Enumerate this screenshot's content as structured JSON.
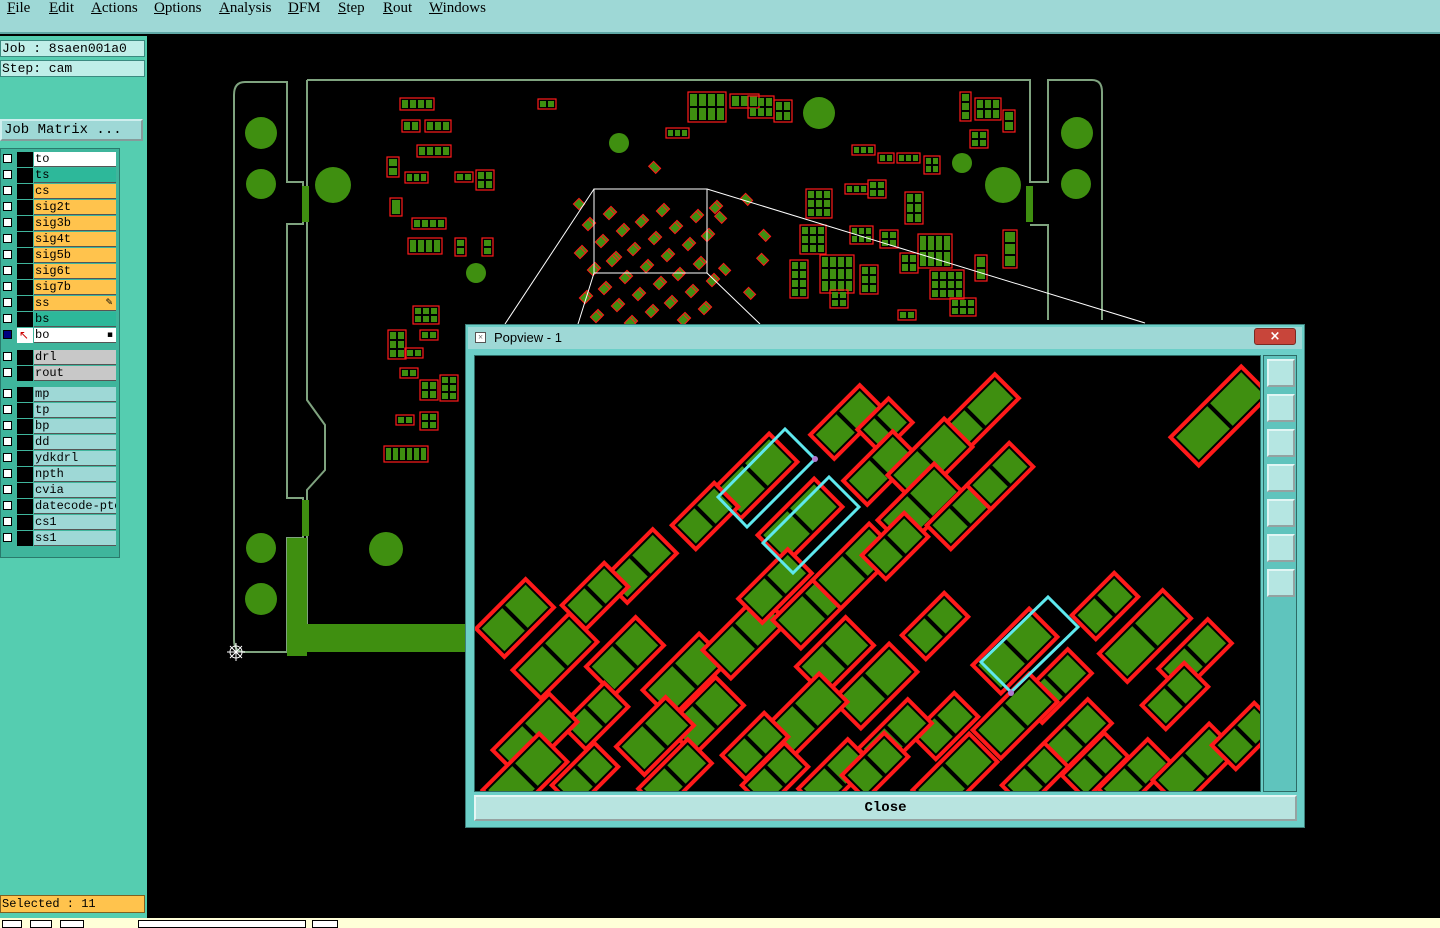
{
  "menu": [
    "File",
    "Edit",
    "Actions",
    "Options",
    "Analysis",
    "DFM",
    "Step",
    "Rout",
    "Windows"
  ],
  "job": {
    "label": "Job : 8saen001a0",
    "step": "Step: cam"
  },
  "job_matrix": "Job Matrix ...",
  "layers_group1": [
    {
      "name": "to",
      "color": "#ffffff"
    },
    {
      "name": "ts",
      "color": "#2db89a"
    },
    {
      "name": "cs",
      "color": "#ffc34d"
    },
    {
      "name": "sig2t",
      "color": "#ffc34d"
    },
    {
      "name": "sig3b",
      "color": "#ffc34d"
    },
    {
      "name": "sig4t",
      "color": "#ffc34d"
    },
    {
      "name": "sig5b",
      "color": "#ffc34d"
    },
    {
      "name": "sig6t",
      "color": "#ffc34d"
    },
    {
      "name": "sig7b",
      "color": "#ffc34d"
    },
    {
      "name": "ss",
      "color": "#ffc34d"
    },
    {
      "name": "bs",
      "color": "#2db89a"
    },
    {
      "name": "bo",
      "color": "#ffffff"
    }
  ],
  "layers_group2": [
    {
      "name": "drl",
      "color": "#c8c8c8"
    },
    {
      "name": "rout",
      "color": "#c8c8c8"
    }
  ],
  "layers_group3": [
    {
      "name": "mp",
      "color": "#9ed8d6"
    },
    {
      "name": "tp",
      "color": "#9ed8d6"
    },
    {
      "name": "bp",
      "color": "#9ed8d6"
    },
    {
      "name": "dd",
      "color": "#9ed8d6"
    },
    {
      "name": "ydkdrl",
      "color": "#9ed8d6"
    },
    {
      "name": "npth",
      "color": "#9ed8d6"
    },
    {
      "name": "cvia",
      "color": "#9ed8d6"
    },
    {
      "name": "datecode-pte",
      "color": "#9ed8d6"
    },
    {
      "name": "cs1",
      "color": "#9ed8d6"
    },
    {
      "name": "ss1",
      "color": "#9ed8d6"
    }
  ],
  "selected": "Selected : 11",
  "popup": {
    "title": "Popview - 1",
    "close_x": "×",
    "close_label": "Close"
  },
  "colors": {
    "pad_fill": "#3f8f10",
    "pad_outline": "#ff1a1a",
    "board_outline": "#7fa37f",
    "highlight": "#5ee8ee",
    "menubar": "#9ed8d6",
    "panel": "#55cdb0"
  }
}
